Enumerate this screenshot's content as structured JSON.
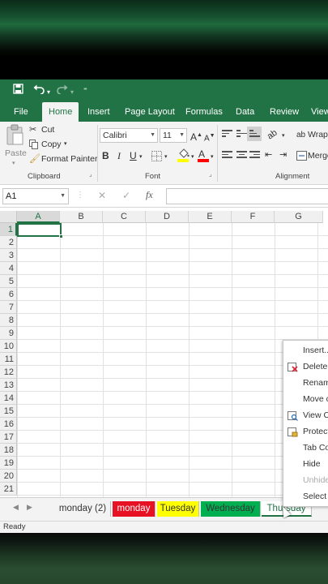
{
  "quick_access": {
    "save_icon": "save-icon",
    "undo_icon": "undo-icon",
    "redo_icon": "redo-icon",
    "customize_icon": "customize-qat-icon"
  },
  "ribbon_tabs": [
    "File",
    "Home",
    "Insert",
    "Page Layout",
    "Formulas",
    "Data",
    "Review",
    "View"
  ],
  "active_tab": "Home",
  "clipboard": {
    "paste": "Paste",
    "cut": "Cut",
    "copy": "Copy",
    "format_painter": "Format Painter",
    "group_label": "Clipboard"
  },
  "font": {
    "name": "Calibri",
    "size": "11",
    "grow": "A",
    "shrink": "A",
    "bold": "B",
    "italic": "I",
    "underline": "U",
    "fill_letter": "",
    "color_letter": "A",
    "group_label": "Font"
  },
  "alignment": {
    "wrap": "Wrap",
    "merge": "Merge",
    "group_label": "Alignment"
  },
  "formula_bar": {
    "name_box": "A1",
    "cancel": "✕",
    "enter": "✓",
    "fx": "fx",
    "value": ""
  },
  "columns": [
    "A",
    "B",
    "C",
    "D",
    "E",
    "F",
    "G"
  ],
  "rows": [
    "1",
    "2",
    "3",
    "4",
    "5",
    "6",
    "7",
    "8",
    "9",
    "10",
    "11",
    "12",
    "13",
    "14",
    "15",
    "16",
    "17",
    "18",
    "19",
    "20",
    "21"
  ],
  "sheet_tabs": [
    {
      "label": "monday (2)",
      "bg": "#f3f3f3",
      "color": "#333333"
    },
    {
      "label": "monday",
      "bg": "#e81123",
      "color": "#ffffff"
    },
    {
      "label": "Tuesday",
      "bg": "#ffff00",
      "color": "#333333"
    },
    {
      "label": "Wednesday",
      "bg": "#00b050",
      "color": "#333333"
    },
    {
      "label": "Thursday",
      "bg": "#ffffff",
      "color": "#333333"
    }
  ],
  "status": "Ready",
  "context_menu": [
    {
      "label": "Insert...",
      "icon": "",
      "disabled": false
    },
    {
      "label": "Delete",
      "icon": "delete-sheet-icon",
      "disabled": false
    },
    {
      "label": "Renam",
      "icon": "",
      "disabled": false
    },
    {
      "label": "Move c",
      "icon": "",
      "disabled": false
    },
    {
      "label": "View Co",
      "icon": "view-code-icon",
      "disabled": false
    },
    {
      "label": "Protect",
      "icon": "protect-sheet-icon",
      "disabled": false
    },
    {
      "label": "Tab Co",
      "icon": "",
      "disabled": false
    },
    {
      "label": "Hide",
      "icon": "",
      "disabled": false
    },
    {
      "label": "Unhide",
      "icon": "",
      "disabled": true
    },
    {
      "label": "Select A",
      "icon": "",
      "disabled": false
    }
  ],
  "colors": {
    "excel_green": "#217346",
    "ribbon_bg": "#f3f3f3"
  }
}
